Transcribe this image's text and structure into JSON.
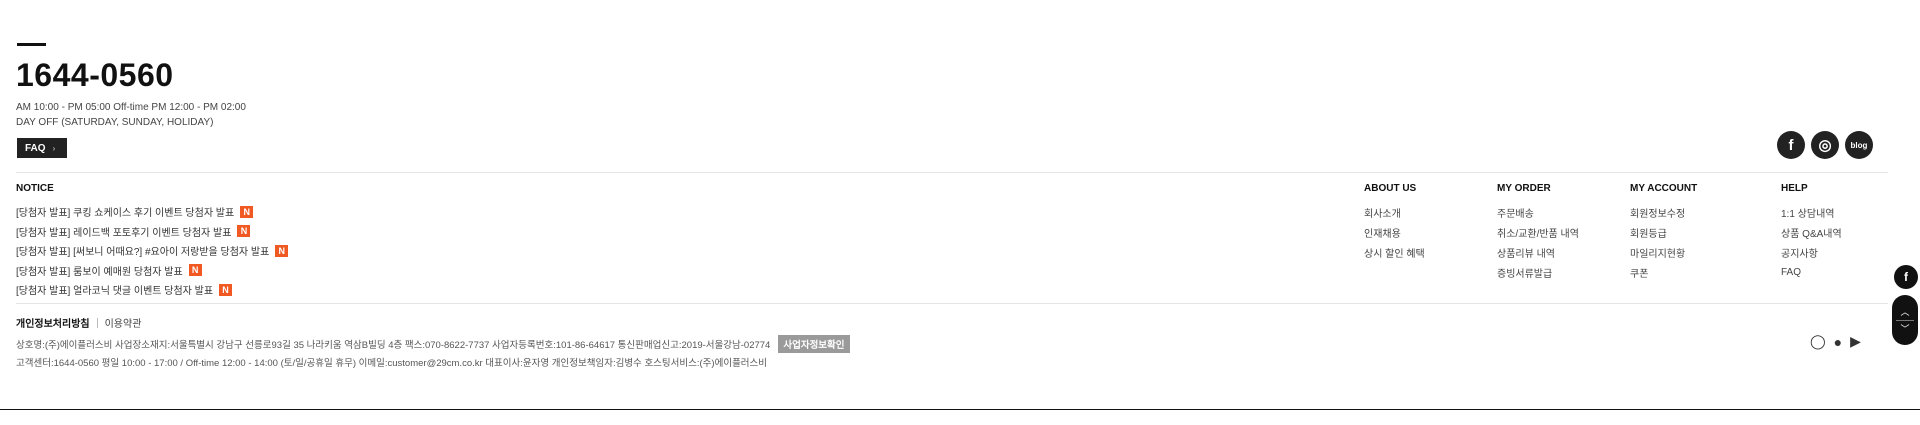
{
  "contact": {
    "phone": "1644-0560",
    "hours_line1": "AM 10:00 - PM 05:00 Off-time PM 12:00 - PM 02:00",
    "hours_line2": "DAY OFF (SATURDAY, SUNDAY, HOLIDAY)",
    "faq_label": "FAQ"
  },
  "social": [
    {
      "name": "facebook-icon",
      "glyph": "f"
    },
    {
      "name": "instagram-icon",
      "glyph": "◎"
    },
    {
      "name": "blog-icon",
      "glyph": "blog"
    }
  ],
  "notice": {
    "title": "NOTICE",
    "badge": "N",
    "items": [
      "[당첨자 발표] 쿠킹 쇼케이스 후기 이벤트 당첨자 발표",
      "[당첨자 발표] 레이드백 포토후기 이벤트 당첨자 발표",
      "[당첨자 발표] [써보니 어때요?] #요아이 저랑받을 당첨자 발표",
      "[당첨자 발표] 룸보이 예매원 당첨자 발표",
      "[당첨자 발표] 얼라코닉 댓글 이벤트 당첨자 발표"
    ]
  },
  "columns": [
    {
      "title": "ABOUT US",
      "items": [
        "회사소개",
        "인재채용",
        "상시 할인 혜택"
      ]
    },
    {
      "title": "MY ORDER",
      "items": [
        "주문배송",
        "취소/교환/반품 내역",
        "상품리뷰 내역",
        "증빙서류발급"
      ]
    },
    {
      "title": "MY ACCOUNT",
      "items": [
        "회원정보수정",
        "회원등급",
        "마일리지현황",
        "쿠폰"
      ]
    },
    {
      "title": "HELP",
      "items": [
        "1:1 상담내역",
        "상품 Q&A내역",
        "공지사항",
        "FAQ"
      ]
    }
  ],
  "policy": {
    "privacy": "개인정보처리방침",
    "terms": "이용약관"
  },
  "business": {
    "line1": "상호명:(주)에이플러스비   사업장소재지:서울특별시 강남구 선릉로93길 35 나라키움 역삼B빌딩 4층   팩스:070-8622-7737   사업자등록번호:101-86-64617   통신판매업신고:2019-서울강남-02774",
    "check_button": "사업자정보확인",
    "line2": "고객센터:1644-0560   평일 10:00 - 17:00 / Off-time 12:00 - 14:00 (토/일/공휴일 휴무)   이메일:customer@29cm.co.kr   대표이사:윤자영   개인정보책임자:김병수   호스팅서비스:(주)에이플러스비"
  },
  "app_badges": [
    {
      "name": "circle-icon",
      "glyph": "◯"
    },
    {
      "name": "apple-icon",
      "glyph": "●"
    },
    {
      "name": "google-play-icon",
      "glyph": "▶"
    }
  ],
  "floating": {
    "facebook_glyph": "f",
    "scroll_up": "︿",
    "scroll_down": "﹀"
  }
}
